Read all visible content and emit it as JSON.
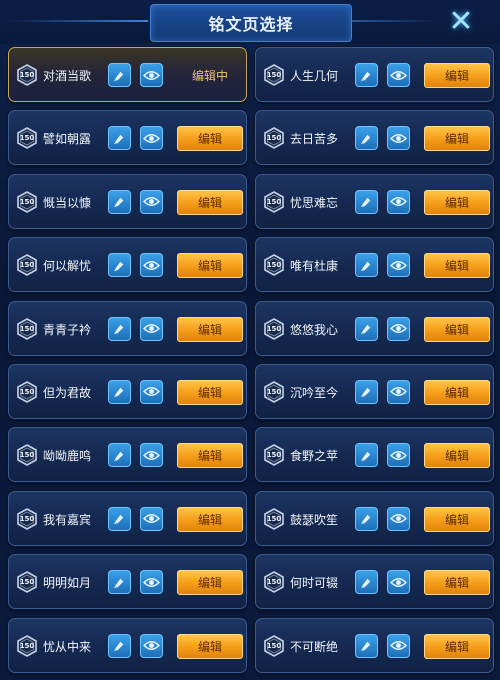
{
  "header": {
    "title": "铭文页选择"
  },
  "icons": {
    "close": "close-x-icon",
    "level": "level-badge-icon",
    "brush": "brush-icon",
    "eye": "eye-icon"
  },
  "colors": {
    "accent": "#f5a21f",
    "active_border": "#c9a557",
    "icon_button": "#2a86d6"
  },
  "pages": [
    {
      "level": "150",
      "name": "对酒当歌",
      "action": "编辑中",
      "active": true
    },
    {
      "level": "150",
      "name": "人生几何",
      "action": "编辑",
      "active": false
    },
    {
      "level": "150",
      "name": "譬如朝露",
      "action": "编辑",
      "active": false
    },
    {
      "level": "150",
      "name": "去日苦多",
      "action": "编辑",
      "active": false
    },
    {
      "level": "150",
      "name": "慨当以慷",
      "action": "编辑",
      "active": false
    },
    {
      "level": "150",
      "name": "忧思难忘",
      "action": "编辑",
      "active": false
    },
    {
      "level": "150",
      "name": "何以解忧",
      "action": "编辑",
      "active": false
    },
    {
      "level": "150",
      "name": "唯有杜康",
      "action": "编辑",
      "active": false
    },
    {
      "level": "150",
      "name": "青青子衿",
      "action": "编辑",
      "active": false
    },
    {
      "level": "150",
      "name": "悠悠我心",
      "action": "编辑",
      "active": false
    },
    {
      "level": "150",
      "name": "但为君故",
      "action": "编辑",
      "active": false
    },
    {
      "level": "150",
      "name": "沉吟至今",
      "action": "编辑",
      "active": false
    },
    {
      "level": "150",
      "name": "呦呦鹿鸣",
      "action": "编辑",
      "active": false
    },
    {
      "level": "150",
      "name": "食野之苹",
      "action": "编辑",
      "active": false
    },
    {
      "level": "150",
      "name": "我有嘉宾",
      "action": "编辑",
      "active": false
    },
    {
      "level": "150",
      "name": "鼓瑟吹笙",
      "action": "编辑",
      "active": false
    },
    {
      "level": "150",
      "name": "明明如月",
      "action": "编辑",
      "active": false
    },
    {
      "level": "150",
      "name": "何时可辍",
      "action": "编辑",
      "active": false
    },
    {
      "level": "150",
      "name": "忧从中来",
      "action": "编辑",
      "active": false
    },
    {
      "level": "150",
      "name": "不可断绝",
      "action": "编辑",
      "active": false
    }
  ]
}
